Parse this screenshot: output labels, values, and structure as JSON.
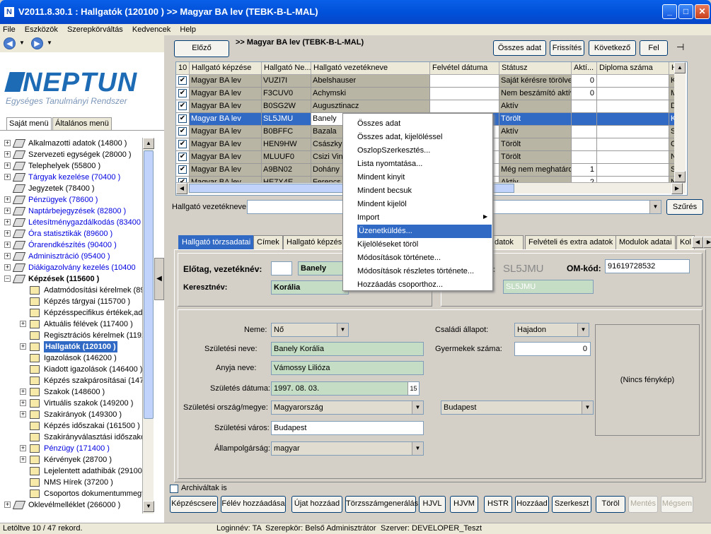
{
  "window": {
    "title": "V2011.8.30.1 : Hallgatók (120100 )   >> Magyar BA lev (TEBK-B-L-MAL)",
    "icon_letter": "N"
  },
  "menu": [
    "File",
    "Eszközök",
    "Szerepkörváltás",
    "Kedvencek",
    "Help"
  ],
  "logo": {
    "name": "NEPTUN",
    "subtitle": "Egységes Tanulmányi Rendszer"
  },
  "left_tabs": [
    "Saját menü",
    "Általános menü"
  ],
  "tree": [
    {
      "label": "Alkalmazotti adatok (14800 )",
      "level": 0,
      "plus": true,
      "color": "black"
    },
    {
      "label": "Szervezeti egységek (28000 )",
      "level": 0,
      "plus": true,
      "color": "black"
    },
    {
      "label": "Telephelyek (55800 )",
      "level": 0,
      "plus": true,
      "color": "black"
    },
    {
      "label": "Tárgyak kezelése (70400 )",
      "level": 0,
      "plus": true,
      "color": "blue"
    },
    {
      "label": "Jegyzetek (78400 )",
      "level": 0,
      "plus": false,
      "color": "black"
    },
    {
      "label": "Pénzügyek (78600 )",
      "level": 0,
      "plus": true,
      "color": "blue"
    },
    {
      "label": "Naptárbejegyzések (82800 )",
      "level": 0,
      "plus": true,
      "color": "blue"
    },
    {
      "label": "Létesítménygazdálkodás (83400",
      "level": 0,
      "plus": true,
      "color": "blue"
    },
    {
      "label": "Óra statisztikák (89600 )",
      "level": 0,
      "plus": true,
      "color": "blue"
    },
    {
      "label": "Órarendkészítés (90400 )",
      "level": 0,
      "plus": true,
      "color": "blue"
    },
    {
      "label": "Adminisztráció (95400 )",
      "level": 0,
      "plus": true,
      "color": "blue"
    },
    {
      "label": "Diákigazolvány kezelés (10400",
      "level": 0,
      "plus": true,
      "color": "blue"
    },
    {
      "label": "Képzések (115600 )",
      "level": 0,
      "plus": true,
      "minus": true,
      "color": "bold"
    },
    {
      "label": "Adatmódosítási kérelmek (89",
      "level": 1,
      "plus": false,
      "color": "black"
    },
    {
      "label": "Képzés tárgyai (115700 )",
      "level": 1,
      "plus": false,
      "color": "black"
    },
    {
      "label": "Képzésspecifikus értékek,ada",
      "level": 1,
      "plus": false,
      "color": "black"
    },
    {
      "label": "Aktuális félévek (117400 )",
      "level": 1,
      "plus": true,
      "color": "black"
    },
    {
      "label": "Regisztrációs kérelmek (1192",
      "level": 1,
      "plus": false,
      "color": "black"
    },
    {
      "label": "Hallgatók (120100 )",
      "level": 1,
      "plus": true,
      "color": "selected"
    },
    {
      "label": "Igazolások (146200 )",
      "level": 1,
      "plus": false,
      "color": "black"
    },
    {
      "label": "Kiadott igazolások (146400 )",
      "level": 1,
      "plus": false,
      "color": "black"
    },
    {
      "label": "Képzés szakpárosításai (147",
      "level": 1,
      "plus": false,
      "color": "black"
    },
    {
      "label": "Szakok (148600 )",
      "level": 1,
      "plus": true,
      "color": "black"
    },
    {
      "label": "Virtuális szakok (149200 )",
      "level": 1,
      "plus": true,
      "color": "black"
    },
    {
      "label": "Szakirányok (149300 )",
      "level": 1,
      "plus": true,
      "color": "black"
    },
    {
      "label": "Képzés időszakai (161500 )",
      "level": 1,
      "plus": false,
      "color": "black"
    },
    {
      "label": "Szakirányválasztási időszakol",
      "level": 1,
      "plus": false,
      "color": "black"
    },
    {
      "label": "Pénzügy (171400 )",
      "level": 1,
      "plus": true,
      "color": "blue"
    },
    {
      "label": "Kérvények (28700 )",
      "level": 1,
      "plus": true,
      "color": "black"
    },
    {
      "label": "Lejelentett adathibák (29100",
      "level": 1,
      "plus": false,
      "color": "black"
    },
    {
      "label": "NMS Hírek (37200 )",
      "level": 1,
      "plus": false,
      "color": "black"
    },
    {
      "label": "Csoportos dokumentummegte",
      "level": 1,
      "plus": false,
      "color": "black"
    },
    {
      "label": "Oklevélmelléklet (266000 )",
      "level": 0,
      "plus": true,
      "color": "black"
    }
  ],
  "toolbar": {
    "prev": "Előző",
    "breadcrumb": ">> Magyar BA lev (TEBK-B-L-MAL)",
    "all_data": "Összes adat",
    "refresh": "Frissítés",
    "next": "Következő",
    "up": "Fel",
    "pin_icon": "pin-icon"
  },
  "grid": {
    "headers": [
      "10",
      "Hallgató képzése",
      "Hallgató Ne...",
      "Hallgató vezetékneve",
      "Felvétel dátuma",
      "Státusz",
      "Aktí...",
      "Diploma száma",
      "Ha"
    ],
    "rows": [
      {
        "training": "Magyar BA lev",
        "code": "VUZI7I",
        "lastname": "Abelshauser",
        "date": "",
        "status": "Saját kérésre törölve",
        "active": "0",
        "diploma": "",
        "ha": "Kaz"
      },
      {
        "training": "Magyar BA lev",
        "code": "F3CUV0",
        "lastname": "Achymski",
        "date": "",
        "status": "Nem beszámító aktív",
        "active": "0",
        "diploma": "",
        "ha": "Mar"
      },
      {
        "training": "Magyar BA lev",
        "code": "B0SG2W",
        "lastname": "Augusztinacz",
        "date": "",
        "status": "Aktív",
        "active": "",
        "diploma": "",
        "ha": "Dor"
      },
      {
        "training": "Magyar BA lev",
        "code": "SL5JMU",
        "lastname": "Banely",
        "date": "",
        "status": "Törölt",
        "active": "",
        "diploma": "",
        "ha": "Kor",
        "selected": true
      },
      {
        "training": "Magyar BA lev",
        "code": "B0BFFC",
        "lastname": "Bazala",
        "date": "",
        "status": "Aktív",
        "active": "",
        "diploma": "",
        "ha": "Sac"
      },
      {
        "training": "Magyar BA lev",
        "code": "HEN9HW",
        "lastname": "Császky",
        "date": "",
        "status": "Törölt",
        "active": "",
        "diploma": "",
        "ha": "Cip"
      },
      {
        "training": "Magyar BA lev",
        "code": "MLUUF0",
        "lastname": "Csizi Vin",
        "date": "",
        "status": "Törölt",
        "active": "",
        "diploma": "",
        "ha": "Nor"
      },
      {
        "training": "Magyar BA lev",
        "code": "A9BN02",
        "lastname": "Dohány",
        "date": "",
        "status": "Még nem meghatározo",
        "active": "1",
        "diploma": "",
        "ha": "Szil"
      },
      {
        "training": "Magyar BA lev",
        "code": "HE7X4E",
        "lastname": "Ferencs",
        "date": "",
        "status": "Aktív",
        "active": "2",
        "diploma": "",
        "ha": "Nin"
      }
    ]
  },
  "filter": {
    "label": "Hallgató vezetékneve",
    "button": "Szűrés"
  },
  "context_menu": [
    "Összes adat",
    "Összes adat, kijelöléssel",
    "OszlopSzerkesztés...",
    "Lista nyomtatása...",
    "Mindent kinyit",
    "Mindent becsuk",
    "Mindent kijelöl",
    "Import",
    "Üzenetküldés...",
    "Kijelöléseket töröl",
    "Módosítások története...",
    "Módosítások részletes története...",
    "Hozzáadás csoporthoz..."
  ],
  "detail_tabs": [
    "Hallgató törzsadatai",
    "Címek",
    "Hallgató képzés",
    "datok",
    "Felvételi és extra adatok",
    "Modulok adatai",
    "Kol"
  ],
  "form": {
    "prefix_label": "Előtag, vezetéknév:",
    "prefix": "",
    "lastname": "Banely",
    "firstname_label": "Keresztnév:",
    "firstname": "Korália",
    "neptun_label_suffix": "d:",
    "neptun": "SL5JMU",
    "om_label": "OM-kód:",
    "om": "91619728532",
    "neptun2": "SL5JMU",
    "gender_label": "Neme:",
    "gender": "Nő",
    "birthname_label": "Születési neve:",
    "birthname": "Banely Korália",
    "mother_label": "Anyja neve:",
    "mother": "Vámossy Lilióza",
    "birthdate_label": "Születés dátuma:",
    "birthdate": "1997. 08. 03.",
    "country_label": "Születési ország/megye:",
    "country": "Magyarország",
    "county": "Budapest",
    "city_label": "Születési város:",
    "city": "Budapest",
    "citizenship_label": "Állampolgárság:",
    "citizenship": "magyar",
    "marital_label": "Családi állapot:",
    "marital": "Hajadon",
    "children_label": "Gyermekek száma:",
    "children": "0",
    "photo": "(Nincs fénykép)"
  },
  "archived_label": "Archiváltak is",
  "bottom_buttons": [
    "Képzéscsere",
    "Félév hozzáadása",
    "Újat hozzáad",
    "Törzsszámgenerálás",
    "HJVL",
    "HJVM",
    "HSTR",
    "Hozzáad",
    "Szerkeszt",
    "Töröl",
    "Mentés",
    "Mégsem"
  ],
  "status": {
    "records": "Letöltve 10 / 47 rekord.",
    "login": "Loginnév: TA",
    "role": "Szerepkör: Belső Adminisztrátor",
    "server": "Szerver: DEVELOPER_Teszt"
  }
}
